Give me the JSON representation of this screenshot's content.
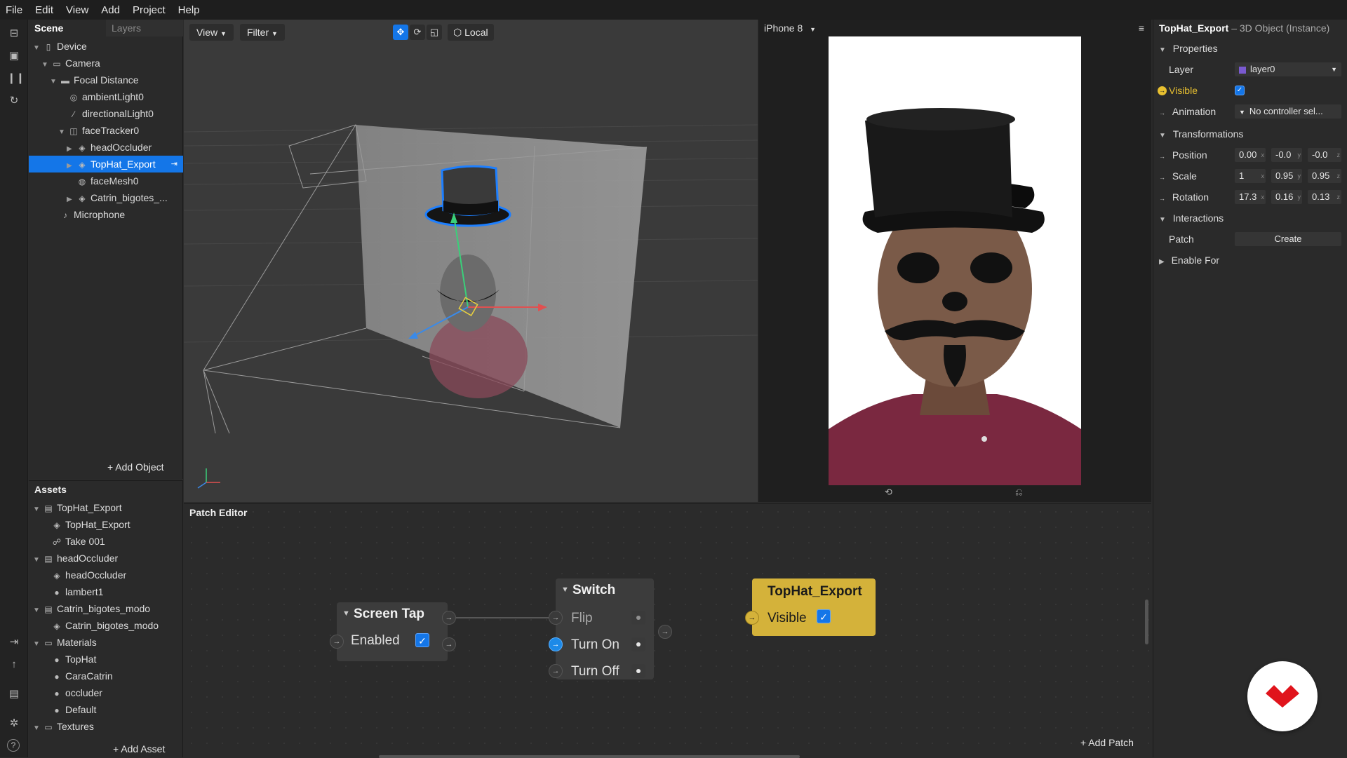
{
  "menu": [
    "File",
    "Edit",
    "View",
    "Add",
    "Project",
    "Help"
  ],
  "scene": {
    "tabs": [
      "Scene",
      "Layers"
    ],
    "tree": [
      {
        "label": "Device",
        "indent": 0,
        "arrow": "▼",
        "icon": "▯"
      },
      {
        "label": "Camera",
        "indent": 1,
        "arrow": "▼",
        "icon": "▭"
      },
      {
        "label": "Focal Distance",
        "indent": 2,
        "arrow": "▼",
        "icon": "▬"
      },
      {
        "label": "ambientLight0",
        "indent": 3,
        "arrow": "",
        "icon": "◎"
      },
      {
        "label": "directionalLight0",
        "indent": 3,
        "arrow": "",
        "icon": "⁄"
      },
      {
        "label": "faceTracker0",
        "indent": 3,
        "arrow": "▼",
        "icon": "◫"
      },
      {
        "label": "headOccluder",
        "indent": 4,
        "arrow": "▶",
        "icon": "◈"
      },
      {
        "label": "TopHat_Export",
        "indent": 4,
        "arrow": "▶",
        "icon": "◈",
        "selected": true
      },
      {
        "label": "faceMesh0",
        "indent": 4,
        "arrow": "",
        "icon": "◍"
      },
      {
        "label": "Catrin_bigotes_...",
        "indent": 4,
        "arrow": "▶",
        "icon": "◈"
      },
      {
        "label": "Microphone",
        "indent": 2,
        "arrow": "",
        "icon": "♪"
      }
    ],
    "add_object": "+ Add Object"
  },
  "assets": {
    "title": "Assets",
    "items": [
      {
        "label": "TopHat_Export",
        "indent": 0,
        "arrow": "▼",
        "icon": "▤"
      },
      {
        "label": "TopHat_Export",
        "indent": 1,
        "arrow": "",
        "icon": "◈"
      },
      {
        "label": "Take 001",
        "indent": 1,
        "arrow": "",
        "icon": "☍"
      },
      {
        "label": "headOccluder",
        "indent": 0,
        "arrow": "▼",
        "icon": "▤"
      },
      {
        "label": "headOccluder",
        "indent": 1,
        "arrow": "",
        "icon": "◈"
      },
      {
        "label": "lambert1",
        "indent": 1,
        "arrow": "",
        "icon": "●"
      },
      {
        "label": "Catrin_bigotes_modo",
        "indent": 0,
        "arrow": "▼",
        "icon": "▤"
      },
      {
        "label": "Catrin_bigotes_modo",
        "indent": 1,
        "arrow": "",
        "icon": "◈"
      },
      {
        "label": "Materials",
        "indent": 0,
        "arrow": "▼",
        "icon": "▭"
      },
      {
        "label": "TopHat",
        "indent": 1,
        "arrow": "",
        "icon": "●"
      },
      {
        "label": "CaraCatrin",
        "indent": 1,
        "arrow": "",
        "icon": "●"
      },
      {
        "label": "occluder",
        "indent": 1,
        "arrow": "",
        "icon": "●"
      },
      {
        "label": "Default",
        "indent": 1,
        "arrow": "",
        "icon": "●"
      },
      {
        "label": "Textures",
        "indent": 0,
        "arrow": "▼",
        "icon": "▭"
      }
    ],
    "add_asset": "+ Add Asset"
  },
  "viewport": {
    "view_label": "View",
    "filter_label": "Filter",
    "local_label": "Local"
  },
  "simulator": {
    "device": "iPhone 8"
  },
  "inspector": {
    "object_name": "TopHat_Export",
    "object_type": " – 3D Object (Instance)",
    "properties_header": "Properties",
    "layer_label": "Layer",
    "layer_value": "layer0",
    "visible_label": "Visible",
    "animation_label": "Animation",
    "animation_value": "No controller sel...",
    "transformations_header": "Transformations",
    "position_label": "Position",
    "position": [
      "0.00",
      "-0.0",
      "-0.0"
    ],
    "scale_label": "Scale",
    "scale": [
      "1",
      "0.95",
      "0.95"
    ],
    "rotation_label": "Rotation",
    "rotation": [
      "17.3",
      "0.16",
      "0.13"
    ],
    "interactions_header": "Interactions",
    "patch_label": "Patch",
    "create_label": "Create",
    "enable_for_label": "Enable For"
  },
  "patch_editor": {
    "title": "Patch Editor",
    "screen_tap": {
      "title": "Screen Tap",
      "enabled_label": "Enabled"
    },
    "switch": {
      "title": "Switch",
      "flip": "Flip",
      "turn_on": "Turn On",
      "turn_off": "Turn Off"
    },
    "tophat": {
      "title": "TopHat_Export",
      "visible_label": "Visible"
    },
    "add_patch": "+ Add Patch"
  },
  "colors": {
    "accent": "#1476e8",
    "patch_yellow": "#d4b23a",
    "brand_red": "#e0141c"
  }
}
